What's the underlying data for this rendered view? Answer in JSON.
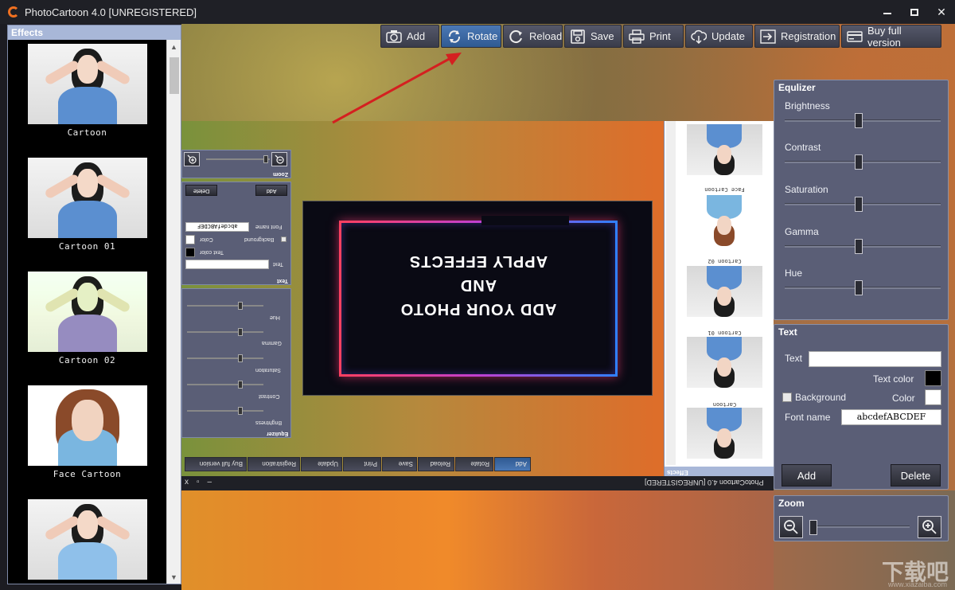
{
  "window": {
    "title": "PhotoCartoon 4.0 [UNREGISTERED]",
    "minimize": "",
    "maximize": "",
    "close": "✕"
  },
  "effects": {
    "header": "Effects",
    "items": [
      {
        "label": "Cartoon",
        "icon": "photo-thumbnail"
      },
      {
        "label": "Cartoon 01",
        "icon": "photo-thumbnail"
      },
      {
        "label": "Cartoon 02",
        "icon": "photo-thumbnail"
      },
      {
        "label": "Face Cartoon",
        "icon": "photo-thumbnail"
      },
      {
        "label": "",
        "icon": "photo-thumbnail"
      }
    ]
  },
  "toolbar": {
    "buttons": [
      {
        "label": "Add",
        "icon": "camera-icon",
        "active": false
      },
      {
        "label": "Rotate",
        "icon": "rotate-icon",
        "active": true
      },
      {
        "label": "Reload",
        "icon": "reload-icon",
        "active": false
      },
      {
        "label": "Save",
        "icon": "save-icon",
        "active": false
      },
      {
        "label": "Print",
        "icon": "print-icon",
        "active": false
      },
      {
        "label": "Update",
        "icon": "cloud-download-icon",
        "active": false
      },
      {
        "label": "Registration",
        "icon": "registration-icon",
        "active": false
      },
      {
        "label": "Buy full version",
        "icon": "card-icon",
        "active": false
      }
    ]
  },
  "preview": {
    "image_text_line1": "ADD YOUR PHOTO",
    "image_text_line2": "AND",
    "image_text_line3": "APPLY EFFECTS",
    "window_title": "PhotoCartoon 4.0 [UNREGISTERED]",
    "effects_header": "Effects",
    "thumb_labels": [
      "Cartoon",
      "Face Cartoon",
      "Cartoon 02",
      "Cartoon 01",
      ""
    ],
    "toolbar": [
      "Add",
      "Rotate",
      "Reload",
      "Save",
      "Print",
      "Update",
      "Registration",
      "Buy full version"
    ],
    "zoom_header": "Zoom",
    "text_header": "Text",
    "text_labels": {
      "text": "Text",
      "text_color": "Text color",
      "background": "Background",
      "color": "Color",
      "font_name": "Font name"
    },
    "font_sample": "abcdefABCDEF",
    "add": "Add",
    "delete": "Delete",
    "eq_header": "Equlizer",
    "eq_labels": [
      "Brightness",
      "Contrast",
      "Saturation",
      "Gamma",
      "Hue"
    ]
  },
  "equalizer": {
    "header": "Equlizer",
    "sliders": [
      {
        "label": "Brightness",
        "value": 0.5
      },
      {
        "label": "Contrast",
        "value": 0.5
      },
      {
        "label": "Saturation",
        "value": 0.5
      },
      {
        "label": "Gamma",
        "value": 0.5
      },
      {
        "label": "Hue",
        "value": 0.5
      }
    ]
  },
  "text_panel": {
    "header": "Text",
    "text_label": "Text",
    "text_value": "",
    "text_color_label": "Text color",
    "text_color": "#000000",
    "background_label": "Background",
    "background_checked": false,
    "color_label": "Color",
    "color": "#ffffff",
    "font_name_label": "Font name",
    "font_sample": "abcdefABCDEF",
    "add_label": "Add",
    "delete_label": "Delete"
  },
  "zoom_panel": {
    "header": "Zoom",
    "zoom_out_icon": "zoom-out-icon",
    "zoom_in_icon": "zoom-in-icon",
    "value": 0.0
  },
  "watermark": {
    "text": "下载吧",
    "sub": "www.xiazaiba.com"
  },
  "colors": {
    "panel_bg": "#5a5e76",
    "active_button": "#3d6aa5",
    "effects_header": "#a8b7d8",
    "arrow": "#d42020"
  }
}
